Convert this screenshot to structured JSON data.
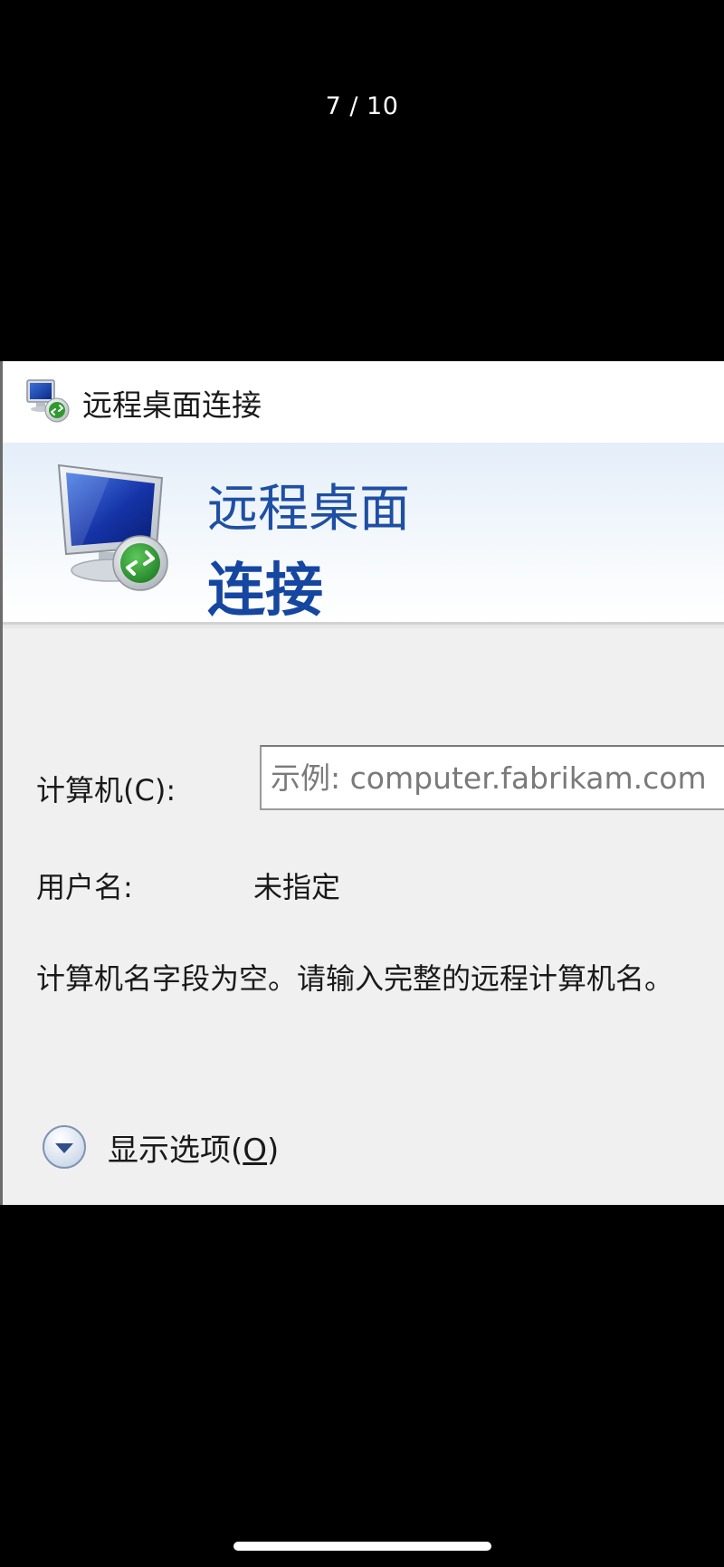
{
  "viewer": {
    "page_counter": "7 / 10"
  },
  "dialog": {
    "title": "远程桌面连接",
    "banner": {
      "line1": "远程桌面",
      "line2": "连接"
    },
    "computer": {
      "label": "计算机(C):",
      "value": "",
      "placeholder": "示例: computer.fabrikam.com"
    },
    "username": {
      "label": "用户名:",
      "value": "未指定"
    },
    "message": "计算机名字段为空。请输入完整的远程计算机名。",
    "options": {
      "label_prefix": "显示选项(",
      "label_mnemonic": "O",
      "label_suffix": ")"
    }
  },
  "icons": {
    "titlebar": "remote-desktop-icon",
    "banner": "remote-desktop-monitor-icon",
    "options": "chevron-down-circle-icon"
  },
  "colors": {
    "banner_title": "#1e4fa3",
    "dialog_background": "#f0f0f0",
    "viewer_background": "#000000"
  }
}
